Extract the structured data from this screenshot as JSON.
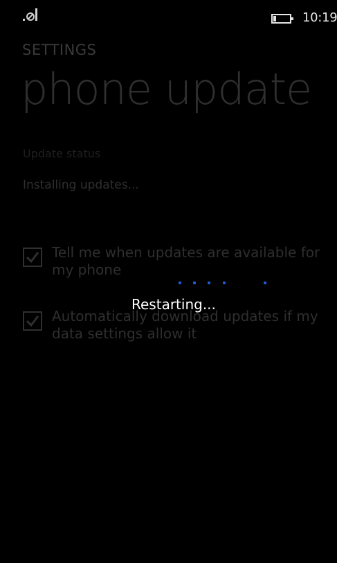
{
  "status_bar": {
    "signal_icon": "signal-off-icon",
    "battery_icon": "battery-icon",
    "time": "10:19"
  },
  "header": {
    "app_title": "SETTINGS",
    "page_title": "phone update"
  },
  "update": {
    "status_label": "Update status",
    "status_value": "Installing updates..."
  },
  "options": [
    {
      "label": "Tell me when updates are available for my phone",
      "checked": true
    },
    {
      "label": "Automatically download updates if my data settings allow it",
      "checked": true
    }
  ],
  "overlay": {
    "message": "Restarting...",
    "progress_indicator": "progress-dots",
    "accent_color": "#1e5bd8"
  }
}
